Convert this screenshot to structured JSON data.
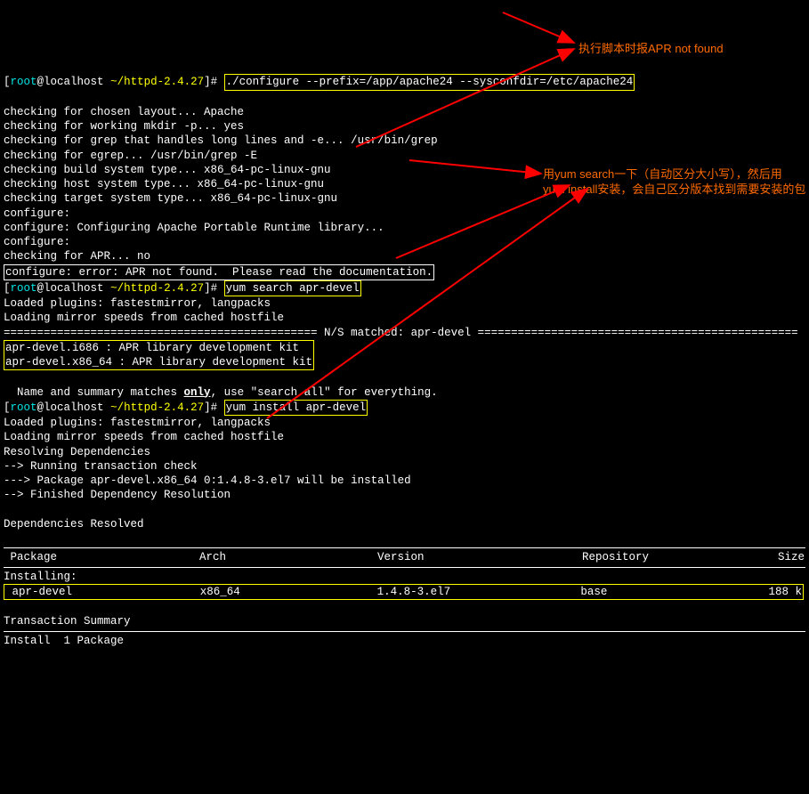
{
  "prompt": {
    "user": "root",
    "host": "localhost",
    "dir": "~/httpd-2.4.27",
    "suffix": "#"
  },
  "commands": {
    "configure": "./configure --prefix=/app/apache24 --sysconfdir=/etc/apache24",
    "yum_search": "yum search apr-devel",
    "yum_install": "yum install apr-devel"
  },
  "configure_output": [
    "checking for chosen layout... Apache",
    "checking for working mkdir -p... yes",
    "checking for grep that handles long lines and -e... /usr/bin/grep",
    "checking for egrep... /usr/bin/grep -E",
    "checking build system type... x86_64-pc-linux-gnu",
    "checking host system type... x86_64-pc-linux-gnu",
    "checking target system type... x86_64-pc-linux-gnu",
    "configure:",
    "configure: Configuring Apache Portable Runtime library...",
    "configure:",
    "checking for APR... no"
  ],
  "configure_error": "configure: error: APR not found.  Please read the documentation.",
  "yum_search_output": {
    "loaded": "Loaded plugins: fastestmirror, langpacks",
    "loading": "Loading mirror speeds from cached hostfile",
    "match_line": "=============================================== N/S matched: apr-devel ================================================",
    "results": [
      "apr-devel.i686 : APR library development kit",
      "apr-devel.x86_64 : APR library development kit"
    ],
    "footer_pre": "  Name and summary matches ",
    "footer_only": "only",
    "footer_post": ", use \"search all\" for everything."
  },
  "yum_install_output": {
    "loaded": "Loaded plugins: fastestmirror, langpacks",
    "loading": "Loading mirror speeds from cached hostfile",
    "resolving": "Resolving Dependencies",
    "running": "--> Running transaction check",
    "package": "---> Package apr-devel.x86_64 0:1.4.8-3.el7 will be installed",
    "finished": "--> Finished Dependency Resolution",
    "deps_resolved": "Dependencies Resolved"
  },
  "table": {
    "headers": {
      "pkg": " Package",
      "arch": "Arch",
      "ver": "Version",
      "repo": "Repository",
      "size": "Size"
    },
    "section": "Installing:",
    "row": {
      "pkg": " apr-devel",
      "arch": "x86_64",
      "ver": "1.4.8-3.el7",
      "repo": "base",
      "size": "188 k"
    }
  },
  "transaction_summary": "Transaction Summary",
  "install_line": "Install  1 Package",
  "annotations": {
    "a1": "执行脚本时报APR not found",
    "a2_line1": "用yum search一下（自动区分大小写），然后用",
    "a2_line2": "yum install安装，会自己区分版本找到需要安装的包"
  }
}
